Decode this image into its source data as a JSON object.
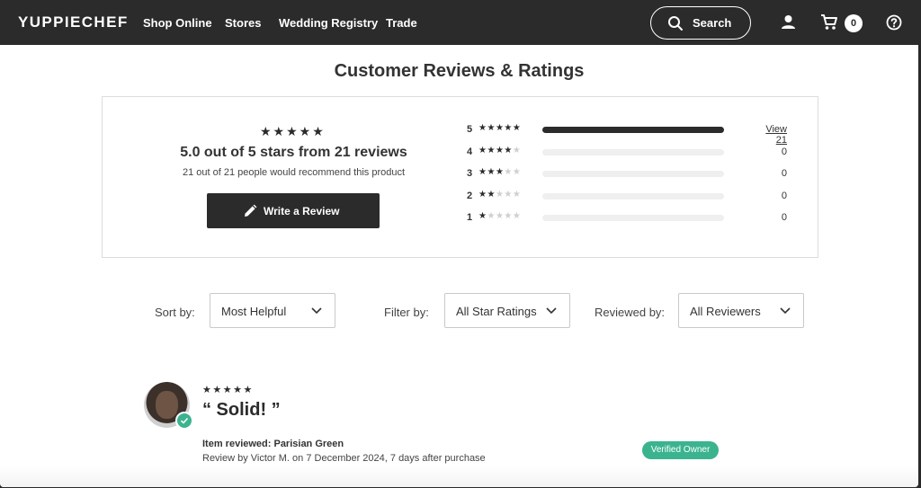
{
  "nav": {
    "logo": "YUPPIECHEF",
    "links": [
      "Shop Online",
      "Stores",
      "Wedding Registry",
      "Trade"
    ],
    "search_label": "Search",
    "cart_count": "0",
    "icons": {
      "search": "search-icon",
      "account": "user-icon",
      "cart": "cart-icon",
      "help": "help-icon"
    }
  },
  "page": {
    "title": "Customer Reviews & Ratings"
  },
  "summary": {
    "stars": "★★★★★",
    "average_line": "5.0 out of 5 stars from 21 reviews",
    "recommend_line": "21 out of 21 people would recommend this product",
    "write_review_label": "Write a Review",
    "breakdown": [
      {
        "stars": "5",
        "filled": 5,
        "fraction": 1.0,
        "count": "View 21"
      },
      {
        "stars": "4",
        "filled": 4,
        "fraction": 0,
        "count": "0"
      },
      {
        "stars": "3",
        "filled": 3,
        "fraction": 0,
        "count": "0"
      },
      {
        "stars": "2",
        "filled": 2,
        "fraction": 0,
        "count": "0"
      },
      {
        "stars": "1",
        "filled": 1,
        "fraction": 0,
        "count": "0"
      }
    ]
  },
  "filters": {
    "sort_label": "Sort by:",
    "sort_value": "Most Helpful",
    "filter_label": "Filter by:",
    "filter_value": "All Star Ratings",
    "reviewed_label": "Reviewed by:",
    "reviewed_value": "All Reviewers"
  },
  "review": {
    "stars": "★★★★★",
    "title": "“ Solid! ”",
    "item_reviewed": "Item reviewed: Parisian Green",
    "byline": "Review by Victor M. on 7 December 2024, 7 days after purchase",
    "badge": "Verified Owner"
  },
  "colors": {
    "nav_bg": "#2b2b2b",
    "accent_green": "#3bb38f",
    "bar_fill": "#2b2b2b",
    "bar_track": "#efefef"
  }
}
